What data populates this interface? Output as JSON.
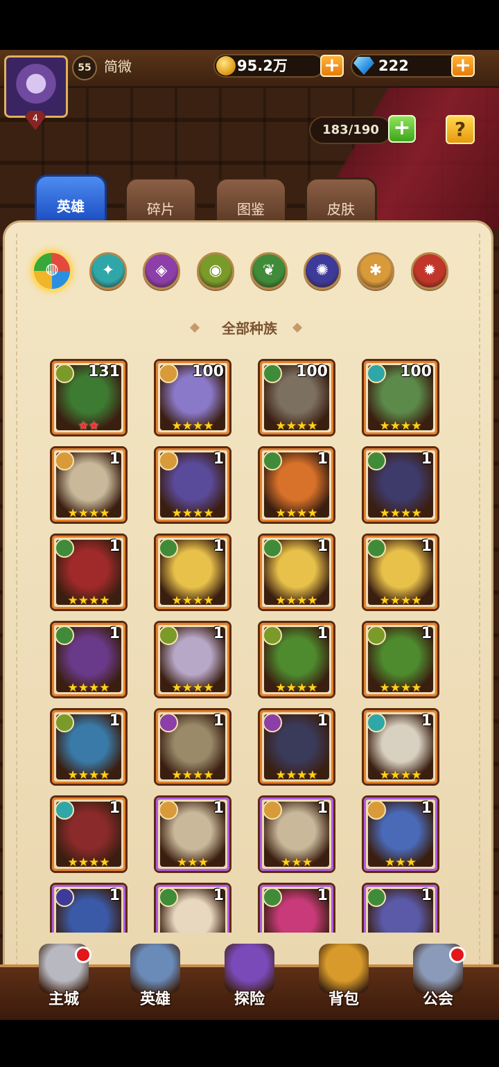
{
  "player": {
    "level": "55",
    "name": "简微",
    "avatar_rank": "4"
  },
  "resources": {
    "gold": "95.2万",
    "gems": "222"
  },
  "roster": {
    "capacity": "183/190",
    "help": "?"
  },
  "tabs": [
    {
      "label": "英雄",
      "active": true
    },
    {
      "label": "碎片",
      "active": false
    },
    {
      "label": "图鉴",
      "active": false
    },
    {
      "label": "皮肤",
      "active": false
    }
  ],
  "factions": [
    {
      "name": "all-factions",
      "color": "#e24b3c",
      "active": true
    },
    {
      "name": "water",
      "color": "#2fa7a8"
    },
    {
      "name": "shadow",
      "color": "#8c3fa8"
    },
    {
      "name": "nature",
      "color": "#7a9a2a"
    },
    {
      "name": "forest",
      "color": "#3f8b3a"
    },
    {
      "name": "demon",
      "color": "#3e3a9a"
    },
    {
      "name": "light",
      "color": "#d99a3a"
    },
    {
      "name": "fire",
      "color": "#c0362a"
    }
  ],
  "faction_title": "全部种族",
  "heroes": [
    {
      "level": "131",
      "stars": "★★",
      "star_color": "red",
      "faction": "nature",
      "tone": "#3d7a32",
      "frame": "orange"
    },
    {
      "level": "100",
      "stars": "★★★★",
      "faction": "light",
      "tone": "#8a79c9",
      "frame": "orange"
    },
    {
      "level": "100",
      "stars": "★★★★",
      "faction": "forest",
      "tone": "#7c7060",
      "frame": "orange"
    },
    {
      "level": "100",
      "stars": "★★★★",
      "faction": "water",
      "tone": "#5c8a4a",
      "frame": "orange"
    },
    {
      "level": "1",
      "stars": "★★★★",
      "faction": "light",
      "tone": "#c9b99a",
      "frame": "orange"
    },
    {
      "level": "1",
      "stars": "★★★★",
      "faction": "light",
      "tone": "#5a4a9a",
      "frame": "orange"
    },
    {
      "level": "1",
      "stars": "★★★★",
      "faction": "forest",
      "tone": "#d8722a",
      "frame": "orange"
    },
    {
      "level": "1",
      "stars": "★★★★",
      "faction": "forest",
      "tone": "#3e3a6a",
      "frame": "orange"
    },
    {
      "level": "1",
      "stars": "★★★★",
      "faction": "forest",
      "tone": "#a02a2a",
      "frame": "orange"
    },
    {
      "level": "1",
      "stars": "★★★★",
      "faction": "forest",
      "tone": "#e8c14a",
      "frame": "orange"
    },
    {
      "level": "1",
      "stars": "★★★★",
      "faction": "forest",
      "tone": "#e8c14a",
      "frame": "orange"
    },
    {
      "level": "1",
      "stars": "★★★★",
      "faction": "forest",
      "tone": "#e8c14a",
      "frame": "orange"
    },
    {
      "level": "1",
      "stars": "★★★★",
      "faction": "forest",
      "tone": "#6a3a8a",
      "frame": "orange"
    },
    {
      "level": "1",
      "stars": "★★★★",
      "faction": "nature",
      "tone": "#b8a8c8",
      "frame": "orange"
    },
    {
      "level": "1",
      "stars": "★★★★",
      "faction": "nature",
      "tone": "#4e8a2e",
      "frame": "orange"
    },
    {
      "level": "1",
      "stars": "★★★★",
      "faction": "nature",
      "tone": "#4e8a2e",
      "frame": "orange"
    },
    {
      "level": "1",
      "stars": "★★★★",
      "faction": "nature",
      "tone": "#3a7aa8",
      "frame": "orange"
    },
    {
      "level": "1",
      "stars": "★★★★",
      "faction": "shadow",
      "tone": "#9a8a6a",
      "frame": "orange"
    },
    {
      "level": "1",
      "stars": "★★★★",
      "faction": "shadow",
      "tone": "#3a3a5a",
      "frame": "orange"
    },
    {
      "level": "1",
      "stars": "★★★★",
      "faction": "water",
      "tone": "#d8d0c0",
      "frame": "orange"
    },
    {
      "level": "1",
      "stars": "★★★★",
      "faction": "water",
      "tone": "#8a2a2a",
      "frame": "orange"
    },
    {
      "level": "1",
      "stars": "★★★",
      "faction": "light",
      "tone": "#c9b99a",
      "frame": "purple"
    },
    {
      "level": "1",
      "stars": "★★★",
      "faction": "light",
      "tone": "#c9b99a",
      "frame": "purple"
    },
    {
      "level": "1",
      "stars": "★★★",
      "faction": "light",
      "tone": "#4a6ab8",
      "frame": "purple"
    },
    {
      "level": "1",
      "stars": "",
      "faction": "demon",
      "tone": "#3a5aa8",
      "frame": "purple"
    },
    {
      "level": "1",
      "stars": "",
      "faction": "forest",
      "tone": "#e8d8c0",
      "frame": "purple"
    },
    {
      "level": "1",
      "stars": "",
      "faction": "forest",
      "tone": "#c83a7a",
      "frame": "purple"
    },
    {
      "level": "1",
      "stars": "",
      "faction": "forest",
      "tone": "#5a5aa8",
      "frame": "purple"
    }
  ],
  "nav": [
    {
      "label": "主城",
      "badge": true,
      "tone": "#b8b8c0"
    },
    {
      "label": "英雄",
      "badge": false,
      "tone": "#6a8ab8"
    },
    {
      "label": "探险",
      "badge": false,
      "tone": "#7a4ab8"
    },
    {
      "label": "背包",
      "badge": false,
      "tone": "#d89a2a"
    },
    {
      "label": "公会",
      "badge": true,
      "tone": "#8a9ab8"
    }
  ]
}
